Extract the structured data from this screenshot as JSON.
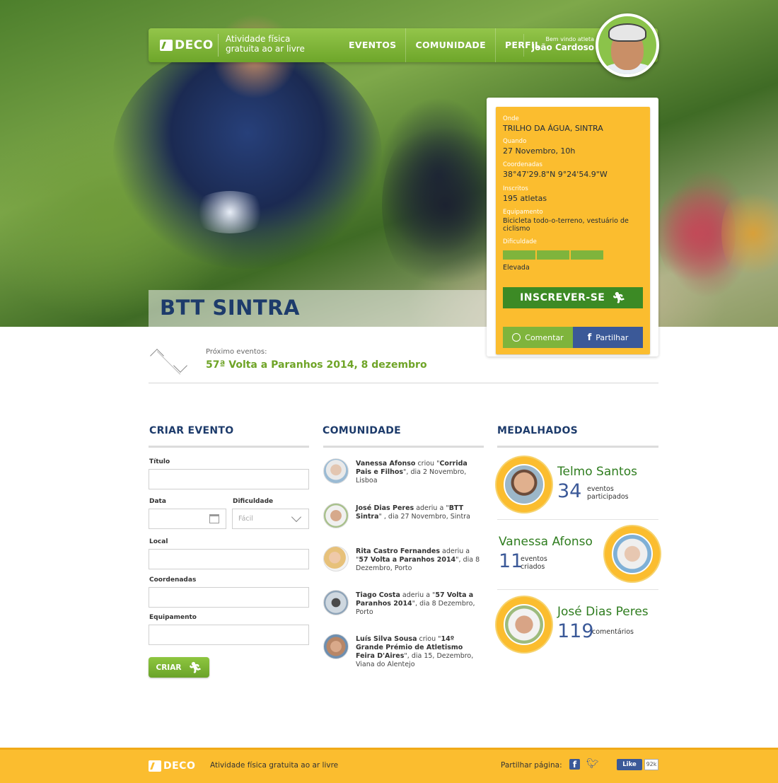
{
  "brand": {
    "logo_text": "DECO",
    "tagline": "Atividade física gratuita ao ar livre"
  },
  "nav": {
    "items": [
      "EVENTOS",
      "COMUNIDADE",
      "PERFIL"
    ],
    "welcome": "Bem vindo atleta",
    "username": "João Cardoso"
  },
  "hero": {
    "title": "BTT SINTRA"
  },
  "event": {
    "where_label": "Onde",
    "where": "TRILHO DA ÁGUA, SINTRA",
    "when_label": "Quando",
    "when": "27 Novembro, 10h",
    "coords_label": "Coordenadas",
    "coords": "38°47'29.8\"N 9°24'54.9\"W",
    "registered_label": "Inscritos",
    "registered": "195 atletas",
    "equipment_label": "Equipamento",
    "equipment": "Bicicleta todo-o-terreno, vestuário de ciclismo",
    "difficulty_label": "Dificuldade",
    "difficulty": "Elevada",
    "difficulty_level": 3,
    "subscribe": "INSCREVER-SE",
    "comment": "Comentar",
    "share": "Partilhar"
  },
  "next_events": {
    "label": "Próximo eventos:",
    "value": "57ª Volta a Paranhos 2014, 8 dezembro"
  },
  "create_event": {
    "title": "CRIAR EVENTO",
    "title_label": "Título",
    "date_label": "Data",
    "difficulty_label": "Dificuldade",
    "difficulty_value": "Fácil",
    "location_label": "Local",
    "coords_label": "Coordenadas",
    "equipment_label": "Equipamento",
    "submit": "CRIAR"
  },
  "community": {
    "title": "COMUNIDADE",
    "items": [
      {
        "name": "Vanessa Afonso",
        "text": " criou \"",
        "event": "Corrida Pais e Filhos",
        "tail": "\", dia 2 Novembro, Lisboa"
      },
      {
        "name": "José Dias Peres",
        "text": " aderiu a \"",
        "event": "BTT Sintra",
        "tail": "\" , dia 27 Novembro, Sintra"
      },
      {
        "name": "Rita Castro Fernandes",
        "text": " aderiu a \"",
        "event": "57 Volta a Paranhos 2014",
        "tail": "\", dia 8 Dezembro, Porto"
      },
      {
        "name": "Tiago Costa",
        "text": " aderiu a \"",
        "event": "57 Volta a Paranhos 2014",
        "tail": "\", dia 8 Dezembro, Porto"
      },
      {
        "name": "Luís Silva Sousa",
        "text": " criou \"",
        "event": "14º Grande Prémio de Atletismo Feira D'Aires",
        "tail": "\", dia 15, Dezembro, Viana do Alentejo"
      }
    ]
  },
  "medals": {
    "title": "MEDALHADOS",
    "items": [
      {
        "name": "Telmo Santos",
        "number": "34",
        "desc": "eventos participados"
      },
      {
        "name": "Vanessa Afonso",
        "number": "11",
        "desc": "eventos criados"
      },
      {
        "name": "José Dias Peres",
        "number": "119",
        "desc": "comentários"
      }
    ]
  },
  "footer": {
    "tagline": "Atividade física gratuita ao ar livre",
    "share_label": "Partilhar página:",
    "like": "Like",
    "like_count": "92k"
  },
  "colors": {
    "green": "#7fb43c",
    "yellow": "#fbbd2f",
    "navy": "#1d3b6b",
    "facebook": "#3b5998"
  }
}
